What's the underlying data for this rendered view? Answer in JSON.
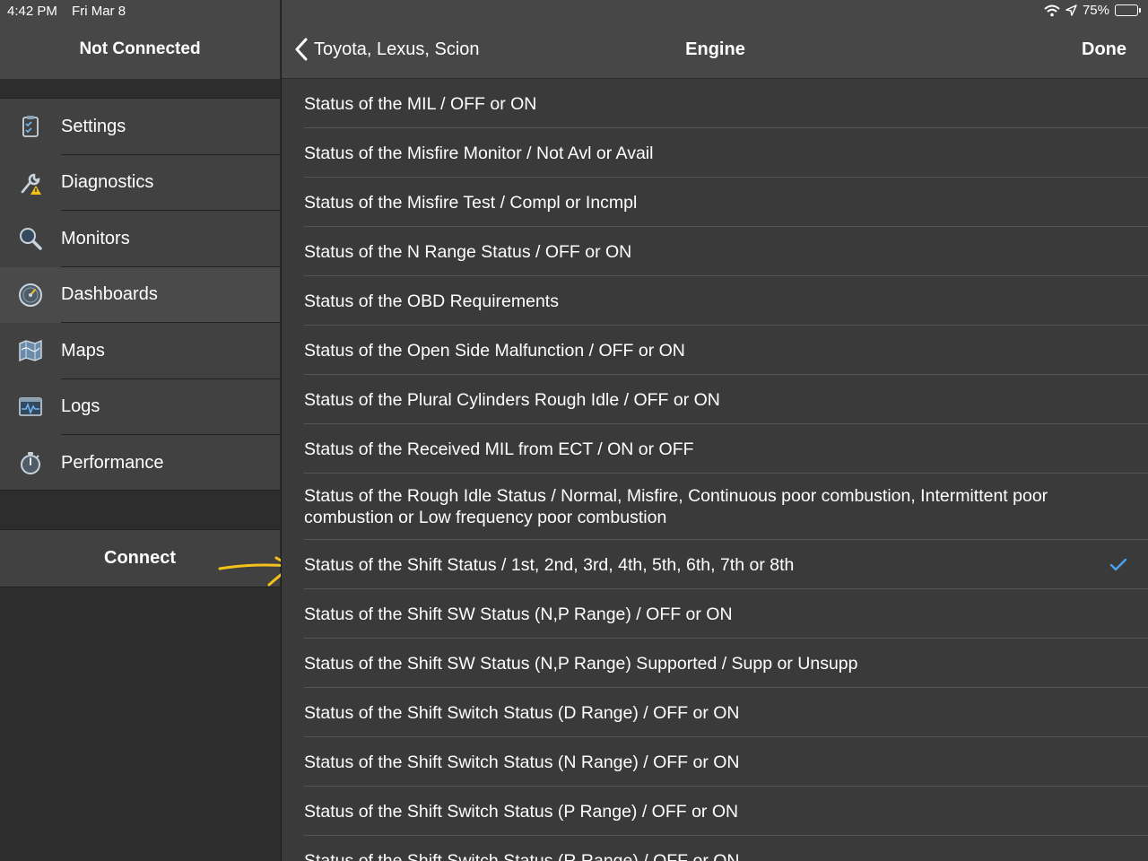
{
  "status_bar": {
    "time": "4:42 PM",
    "date": "Fri Mar 8",
    "battery": "75%",
    "battery_level": 0.75,
    "wifi_icon": "wifi-icon",
    "location_icon": "location-arrow-icon"
  },
  "sidebar": {
    "title": "Not Connected",
    "items": [
      {
        "label": "Settings",
        "icon": "clipboard-check-icon"
      },
      {
        "label": "Diagnostics",
        "icon": "wrench-warning-icon"
      },
      {
        "label": "Monitors",
        "icon": "magnifier-icon"
      },
      {
        "label": "Dashboards",
        "icon": "gauge-icon",
        "active": true
      },
      {
        "label": "Maps",
        "icon": "map-icon"
      },
      {
        "label": "Logs",
        "icon": "waveform-monitor-icon"
      },
      {
        "label": "Performance",
        "icon": "stopwatch-icon"
      }
    ],
    "connect_label": "Connect"
  },
  "header": {
    "back_label": "Toyota, Lexus, Scion",
    "title": "Engine",
    "done_label": "Done"
  },
  "list": {
    "items": [
      {
        "label": "Status of the MIL / OFF or ON"
      },
      {
        "label": "Status of the Misfire Monitor / Not Avl or Avail"
      },
      {
        "label": "Status of the Misfire Test / Compl or Incmpl"
      },
      {
        "label": "Status of the N Range Status / OFF or ON"
      },
      {
        "label": "Status of the OBD Requirements"
      },
      {
        "label": "Status of the Open Side Malfunction / OFF or ON"
      },
      {
        "label": "Status of the Plural Cylinders Rough Idle / OFF or ON"
      },
      {
        "label": "Status of the Received MIL from ECT / ON or OFF"
      },
      {
        "label": "Status of the Rough Idle Status / Normal, Misfire, Continuous poor combustion, Intermittent poor combustion or Low frequency poor combustion"
      },
      {
        "label": "Status of the Shift Status / 1st, 2nd, 3rd, 4th, 5th, 6th, 7th or 8th",
        "selected": true
      },
      {
        "label": "Status of the Shift SW Status (N,P Range) / OFF or ON"
      },
      {
        "label": "Status of the Shift SW Status (N,P Range) Supported / Supp or Unsupp"
      },
      {
        "label": "Status of the Shift Switch Status (D Range) / OFF or ON"
      },
      {
        "label": "Status of the Shift Switch Status (N Range) / OFF or ON"
      },
      {
        "label": "Status of the Shift Switch Status (P Range) / OFF or ON"
      },
      {
        "label": "Status of the Shift Switch Status (R Range) / OFF or ON"
      }
    ]
  },
  "colors": {
    "accent_check": "#4aa3f0",
    "annotation_arrow": "#f2c21b"
  }
}
